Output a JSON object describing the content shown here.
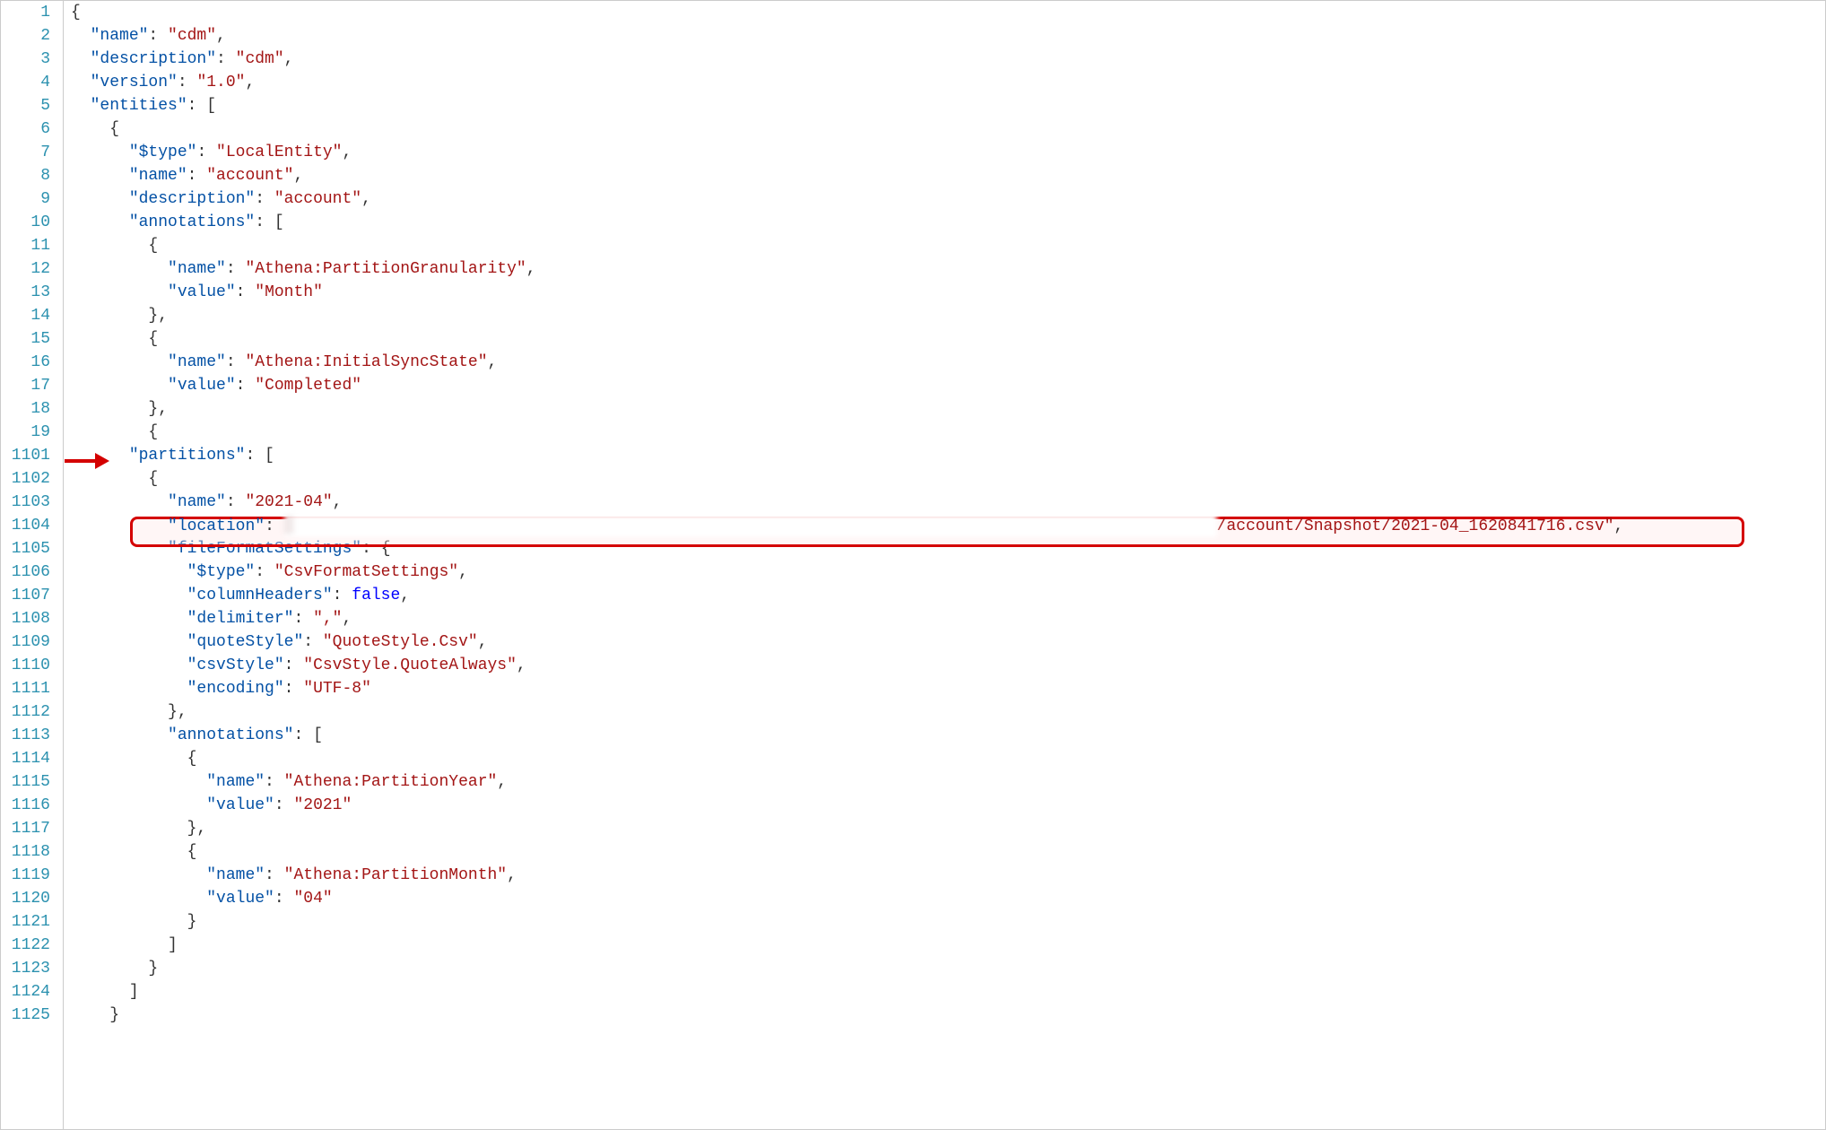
{
  "lineNumbers": [
    "1",
    "2",
    "3",
    "4",
    "5",
    "6",
    "7",
    "8",
    "9",
    "10",
    "11",
    "12",
    "13",
    "14",
    "15",
    "16",
    "17",
    "18",
    "19",
    "1101",
    "1102",
    "1103",
    "1104",
    "1105",
    "1106",
    "1107",
    "1108",
    "1109",
    "1110",
    "1111",
    "1112",
    "1113",
    "1114",
    "1115",
    "1116",
    "1117",
    "1118",
    "1119",
    "1120",
    "1121",
    "1122",
    "1123",
    "1124",
    "1125"
  ],
  "code": {
    "l1": {
      "t0": "{"
    },
    "l2": {
      "k": "\"name\"",
      "v": "\"cdm\""
    },
    "l3": {
      "k": "\"description\"",
      "v": "\"cdm\""
    },
    "l4": {
      "k": "\"version\"",
      "v": "\"1.0\""
    },
    "l5": {
      "k": "\"entities\""
    },
    "l6": {
      "t0": "{"
    },
    "l7": {
      "k": "\"$type\"",
      "v": "\"LocalEntity\""
    },
    "l8": {
      "k": "\"name\"",
      "v": "\"account\""
    },
    "l9": {
      "k": "\"description\"",
      "v": "\"account\""
    },
    "l10": {
      "k": "\"annotations\""
    },
    "l11": {
      "t0": "{"
    },
    "l12": {
      "k": "\"name\"",
      "v": "\"Athena:PartitionGranularity\""
    },
    "l13": {
      "k": "\"value\"",
      "v": "\"Month\""
    },
    "l14": {
      "t0": "},"
    },
    "l15": {
      "t0": "{"
    },
    "l16": {
      "k": "\"name\"",
      "v": "\"Athena:InitialSyncState\""
    },
    "l17": {
      "k": "\"value\"",
      "v": "\"Completed\""
    },
    "l18": {
      "t0": "},"
    },
    "l19": {
      "t0": "{"
    },
    "l1101": {
      "k": "\"partitions\""
    },
    "l1102": {
      "t0": "{"
    },
    "l1103": {
      "k": "\"name\"",
      "v": "\"2021-04\""
    },
    "l1104": {
      "k": "\"location\"",
      "v": "/account/Snapshot/2021-04_1620841716.csv\""
    },
    "l1105": {
      "k": "\"fileFormatSettings\""
    },
    "l1106": {
      "k": "\"$type\"",
      "v": "\"CsvFormatSettings\""
    },
    "l1107": {
      "k": "\"columnHeaders\"",
      "v": "false"
    },
    "l1108": {
      "k": "\"delimiter\"",
      "v": "\",\""
    },
    "l1109": {
      "k": "\"quoteStyle\"",
      "v": "\"QuoteStyle.Csv\""
    },
    "l1110": {
      "k": "\"csvStyle\"",
      "v": "\"CsvStyle.QuoteAlways\""
    },
    "l1111": {
      "k": "\"encoding\"",
      "v": "\"UTF-8\""
    },
    "l1112": {
      "t0": "},"
    },
    "l1113": {
      "k": "\"annotations\""
    },
    "l1114": {
      "t0": "{"
    },
    "l1115": {
      "k": "\"name\"",
      "v": "\"Athena:PartitionYear\""
    },
    "l1116": {
      "k": "\"value\"",
      "v": "\"2021\""
    },
    "l1117": {
      "t0": "},"
    },
    "l1118": {
      "t0": "{"
    },
    "l1119": {
      "k": "\"name\"",
      "v": "\"Athena:PartitionMonth\""
    },
    "l1120": {
      "k": "\"value\"",
      "v": "\"04\""
    },
    "l1121": {
      "t0": "}"
    },
    "l1122": {
      "t0": "]"
    },
    "l1123": {
      "t0": "}"
    },
    "l1124": {
      "t0": "]"
    },
    "l1125": {
      "t0": "}"
    }
  },
  "annotations": {
    "arrowLine": "1101",
    "highlightLine": "1104"
  }
}
